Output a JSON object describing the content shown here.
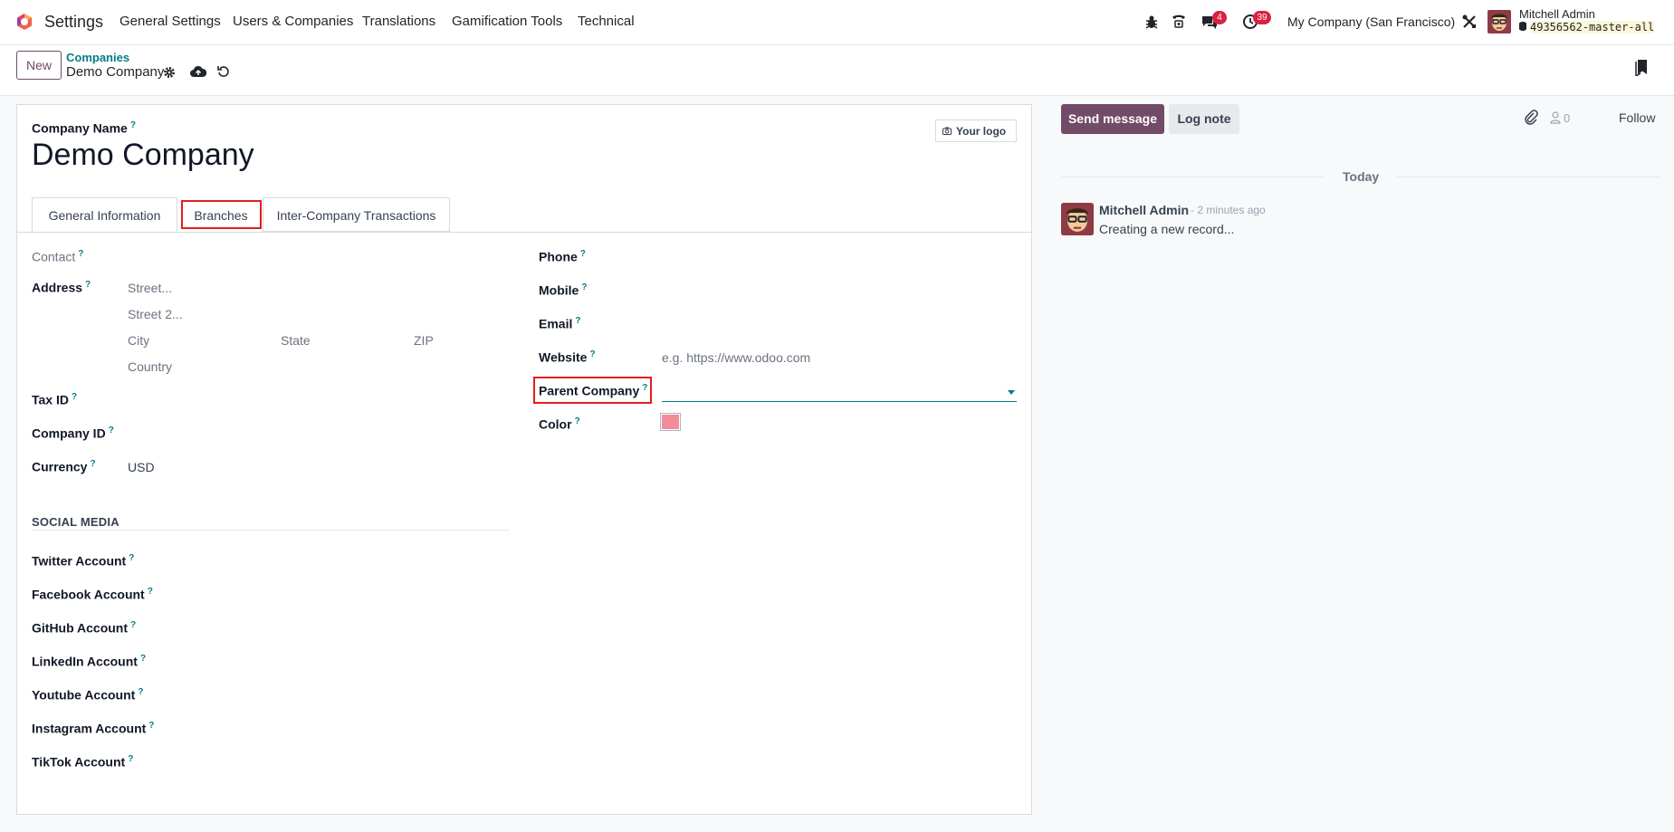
{
  "navbar": {
    "app_name": "Settings",
    "menu": [
      "General Settings",
      "Users & Companies",
      "Translations",
      "Gamification Tools",
      "Technical"
    ],
    "messages_badge": "4",
    "activities_badge": "39",
    "company": "My Company (San Francisco)",
    "user_name": "Mitchell Admin",
    "db_name": "49356562-master-all"
  },
  "control": {
    "new_label": "New",
    "breadcrumb_parent": "Companies",
    "breadcrumb_current": "Demo Company"
  },
  "form": {
    "company_name_label": "Company Name",
    "company_name": "Demo Company",
    "logo_label": "Your logo",
    "tabs": [
      "General Information",
      "Branches",
      "Inter-Company Transactions"
    ],
    "left": {
      "contact": "Contact",
      "address": "Address",
      "street_ph": "Street...",
      "street2_ph": "Street 2...",
      "city_ph": "City",
      "state_ph": "State",
      "zip_ph": "ZIP",
      "country_ph": "Country",
      "tax_id": "Tax ID",
      "company_id": "Company ID",
      "currency": "Currency",
      "currency_value": "USD"
    },
    "right": {
      "phone": "Phone",
      "mobile": "Mobile",
      "email": "Email",
      "website": "Website",
      "website_ph": "e.g. https://www.odoo.com",
      "parent_company": "Parent Company",
      "color": "Color",
      "color_value": "#f28b9a"
    },
    "social_title": "SOCIAL MEDIA",
    "social": [
      "Twitter Account",
      "Facebook Account",
      "GitHub Account",
      "LinkedIn Account",
      "Youtube Account",
      "Instagram Account",
      "TikTok Account"
    ],
    "help_mark": "?"
  },
  "chatter": {
    "send_message": "Send message",
    "log_note": "Log note",
    "followers_count": "0",
    "follow": "Follow",
    "date_separator": "Today",
    "message_author": "Mitchell Admin",
    "message_time": "- 2 minutes ago",
    "message_body": "Creating a new record..."
  },
  "colors": {
    "brand": "#714b67",
    "teal": "#017e84",
    "highlight": "#e51d1d"
  }
}
